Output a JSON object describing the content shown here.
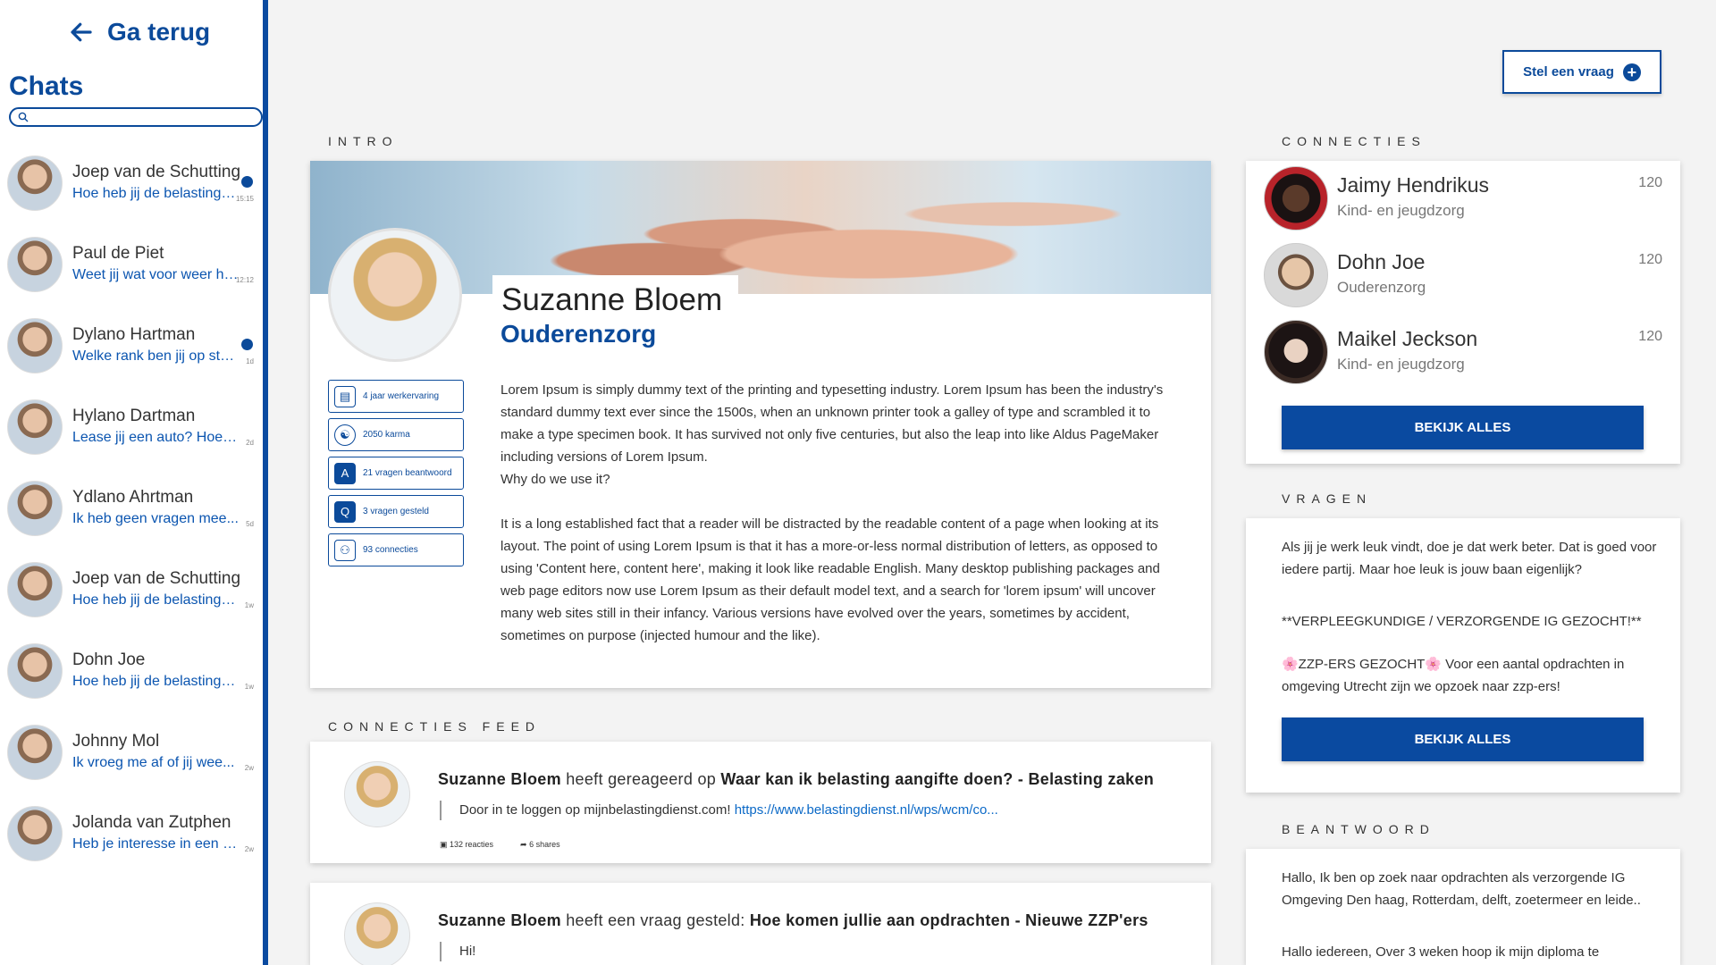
{
  "sidebar": {
    "back_label": "Ga terug",
    "title": "Chats",
    "search_placeholder": "",
    "chats": [
      {
        "name": "Joep van de Schutting",
        "preview": "Hoe heb jij de belastinga...",
        "time": "15:15",
        "unread": true
      },
      {
        "name": "Paul de Piet",
        "preview": "Weet jij wat voor weer he...",
        "time": "12:12",
        "unread": false
      },
      {
        "name": "Dylano Hartman",
        "preview": "Welke rank ben jij op star...",
        "time": "1d",
        "unread": true
      },
      {
        "name": "Hylano Dartman",
        "preview": "Lease jij een auto? Hoe v...",
        "time": "2d",
        "unread": false
      },
      {
        "name": "Ydlano Ahrtman",
        "preview": "Ik heb geen vragen mee...",
        "time": "5d",
        "unread": false
      },
      {
        "name": "Joep van de Schutting",
        "preview": "Hoe heb jij de belastinga...",
        "time": "1w",
        "unread": false
      },
      {
        "name": "Dohn Joe",
        "preview": "Hoe heb jij de belastinga...",
        "time": "1w",
        "unread": false
      },
      {
        "name": "Johnny Mol",
        "preview": "Ik vroeg me af of jij wee...",
        "time": "2w",
        "unread": false
      },
      {
        "name": "Jolanda van Zutphen",
        "preview": "Heb je interesse in een si...",
        "time": "2w",
        "unread": false
      }
    ]
  },
  "header": {
    "ask_button_label": "Stel een vraag"
  },
  "intro": {
    "section_title": "INTRO",
    "name": "Suzanne Bloem",
    "profession": "Ouderenzorg",
    "stats": [
      {
        "icon": "briefcase-icon",
        "label": "4 jaar werkervaring"
      },
      {
        "icon": "yin-yang-icon",
        "label": "2050 karma"
      },
      {
        "icon": "answer-icon",
        "label": "21 vragen beantwoord"
      },
      {
        "icon": "question-icon",
        "label": "3 vragen gesteld"
      },
      {
        "icon": "network-icon",
        "label": "93 connecties"
      }
    ],
    "paragraph1": "Lorem Ipsum is simply dummy text of the printing and typesetting industry. Lorem Ipsum has been the industry's standard dummy text ever since the 1500s, when an unknown printer took a galley of type and scrambled it to make a type specimen book. It has survived not only five centuries, but also the leap into like Aldus PageMaker including versions of Lorem Ipsum.",
    "paragraph1b": "Why do we use it?",
    "paragraph2": "It is a long established fact that a reader will be distracted by the readable content of a page when looking at its layout. The point of using Lorem Ipsum is that it has a more-or-less normal distribution of letters, as opposed to using 'Content here, content here', making it look like readable English. Many desktop publishing packages and web page editors now use Lorem Ipsum as their default model text, and a search for 'lorem ipsum' will uncover many web sites still in their infancy. Various versions have evolved over the years, sometimes by accident, sometimes on purpose (injected humour and the like)."
  },
  "feed": {
    "section_title": "CONNECTIES FEED",
    "items": [
      {
        "author": "Suzanne Bloem",
        "action": "heeft gereageerd op",
        "subject": "Waar kan ik belasting aangifte doen?  - Belasting zaken",
        "quote": "Door in te loggen op mijnbelastingdienst.com!",
        "link": "https://www.belastingdienst.nl/wps/wcm/co...",
        "reactions": "132 reacties",
        "shares": "6 shares"
      },
      {
        "author": "Suzanne Bloem",
        "action": "heeft een vraag gesteld:",
        "subject": "Hoe komen jullie aan opdrachten  - Nieuwe ZZP'ers",
        "quote": "Hi!"
      }
    ]
  },
  "connections": {
    "section_title": "CONNECTIES",
    "items": [
      {
        "name": "Jaimy Hendrikus",
        "sector": "Kind- en jeugdzorg",
        "count": "120"
      },
      {
        "name": "Dohn Joe",
        "sector": "Ouderenzorg",
        "count": "120"
      },
      {
        "name": "Maikel Jeckson",
        "sector": "Kind- en jeugdzorg",
        "count": "120"
      }
    ],
    "button_label": "BEKIJK ALLES"
  },
  "questions": {
    "section_title": "VRAGEN",
    "items": [
      "Als jij je werk leuk vindt, doe je dat werk beter. Dat is goed voor iedere partij. Maar hoe leuk is jouw baan eigenlijk?",
      "**VERPLEEGKUNDIGE / VERZORGENDE IG GEZOCHT!**",
      "🌸ZZP-ERS GEZOCHT🌸 Voor een aantal opdrachten in omgeving Utrecht zijn we opzoek naar zzp-ers!"
    ],
    "button_label": "BEKIJK ALLES"
  },
  "answers": {
    "section_title": "BEANTWOORD",
    "items": [
      "Hallo, Ik ben op zoek naar opdrachten als verzorgende IG Omgeving Den haag, Rotterdam, delft, zoetermeer en leide..",
      "Hallo iedereen, Over 3 weken hoop ik mijn diploma te"
    ]
  },
  "colors": {
    "brand": "#0a4aa0",
    "link": "#0b69c7"
  }
}
